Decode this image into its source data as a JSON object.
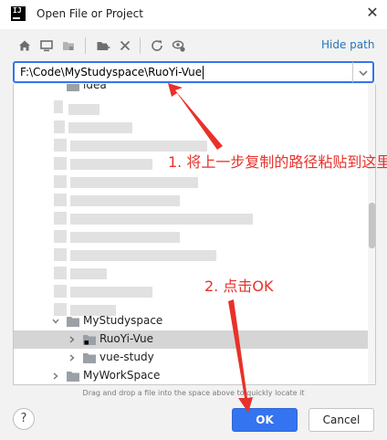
{
  "window": {
    "title": "Open File or Project",
    "app_icon_text": "IJ",
    "close_glyph": "✕"
  },
  "toolbar": {
    "buttons": [
      "home-icon",
      "desktop-icon",
      "project-folder-icon",
      "new-folder-icon",
      "delete-icon",
      "refresh-icon",
      "show-hidden-icon"
    ],
    "hide_path_label": "Hide path"
  },
  "path_field": {
    "value": "F:\\Code\\MyStudyspace\\RuoYi-Vue"
  },
  "tree": {
    "partial_top_label": "idea",
    "items": [
      {
        "label": "MyStudyspace",
        "expanded": true,
        "selected": false
      },
      {
        "label": "RuoYi-Vue",
        "expanded": false,
        "selected": true
      },
      {
        "label": "vue-study",
        "expanded": false,
        "selected": false
      },
      {
        "label": "MyWorkSpace",
        "expanded": false,
        "selected": false
      }
    ]
  },
  "hint": "Drag and drop a file into the space above to quickly locate it",
  "buttons": {
    "help": "?",
    "ok": "OK",
    "cancel": "Cancel"
  },
  "annotations": {
    "step1": "1. 将上一步复制的路径粘贴到这里",
    "step2": "2. 点击OK"
  },
  "colors": {
    "accent": "#3574f0",
    "link": "#2675bf",
    "annotation": "#e8312a",
    "selection": "#d5d5d5"
  }
}
